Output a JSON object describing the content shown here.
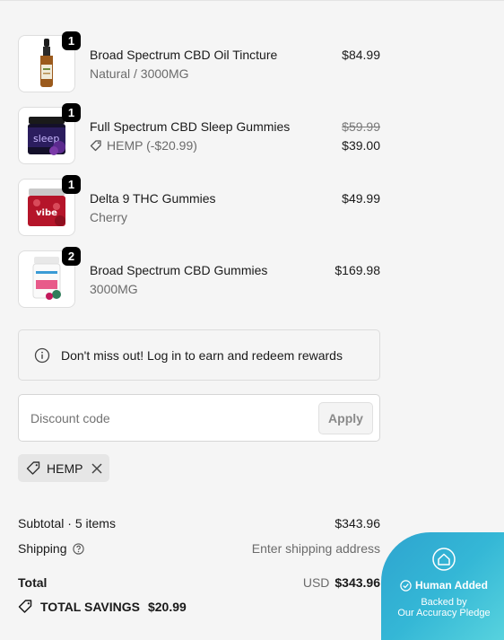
{
  "cart": {
    "items": [
      {
        "quantity": "1",
        "name": "Broad Spectrum CBD Oil Tincture",
        "variant": "Natural / 3000MG",
        "price": "$84.99"
      },
      {
        "quantity": "1",
        "name": "Full Spectrum CBD Sleep Gummies",
        "discount_label": "HEMP (-$20.99)",
        "original_price": "$59.99",
        "price": "$39.00"
      },
      {
        "quantity": "1",
        "name": "Delta 9 THC Gummies",
        "variant": "Cherry",
        "price": "$49.99"
      },
      {
        "quantity": "2",
        "name": "Broad Spectrum CBD Gummies",
        "variant": "3000MG",
        "price": "$169.98"
      }
    ],
    "images": [
      {
        "icon": "tincture-bottle-image"
      },
      {
        "icon": "sleep-gummies-jar-image",
        "jar_text": "sleep"
      },
      {
        "icon": "vibe-gummies-jar-image",
        "jar_text": "vibe"
      },
      {
        "icon": "cbd-gummies-jar-image"
      }
    ]
  },
  "rewards": {
    "message": "Don't miss out! Log in to earn and redeem rewards"
  },
  "discount": {
    "placeholder": "Discount code",
    "apply_label": "Apply",
    "applied_code": "HEMP"
  },
  "summary": {
    "subtotal_label": "Subtotal · 5 items",
    "subtotal_value": "$343.96",
    "shipping_label": "Shipping",
    "shipping_value": "Enter shipping address",
    "total_label": "Total",
    "currency": "USD",
    "total_value": "$343.96",
    "savings_label": "TOTAL SAVINGS",
    "savings_value": "$20.99"
  },
  "badge": {
    "title": "Human Added",
    "line1": "Backed by",
    "line2": "Our Accuracy Pledge"
  },
  "colors": {
    "badge": "#34b7d6",
    "qty_badge": "#000000",
    "page_bg": "#f5f5f5"
  }
}
